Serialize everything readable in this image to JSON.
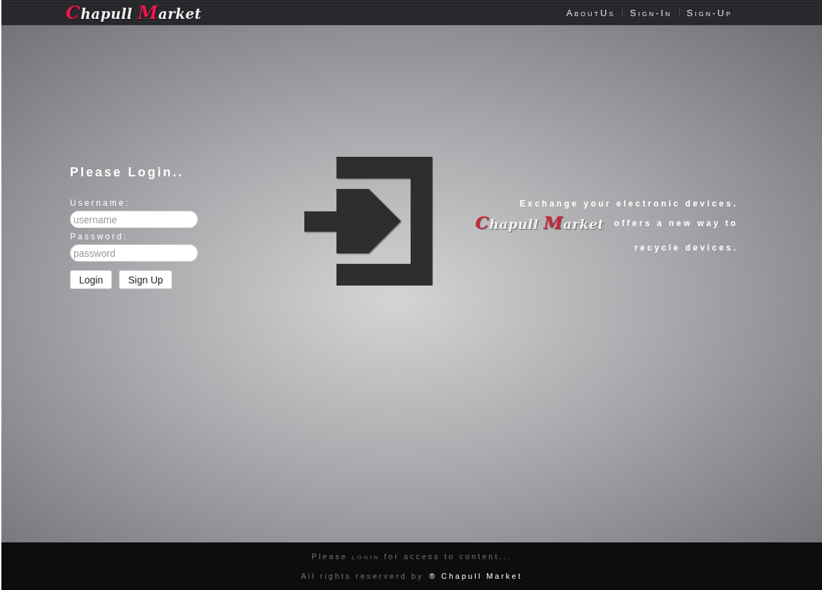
{
  "header": {
    "logo": "Chapull Market",
    "nav": [
      {
        "label": "AboutUs"
      },
      {
        "label": "Sign-In"
      },
      {
        "label": "Sign-Up"
      }
    ]
  },
  "login": {
    "title": "Please Login..",
    "fields": [
      {
        "label": "Username:",
        "placeholder": "username"
      },
      {
        "label": "Password:",
        "placeholder": "password"
      }
    ],
    "buttons": [
      "Login",
      "Sign Up"
    ]
  },
  "tagline": {
    "line1": "Exchange your electronic devices.",
    "logo": "Chapull Market",
    "line2": "offers a new way to",
    "line3": "recycle devices."
  },
  "footer": {
    "notice": [
      {
        "text": "Please ",
        "small_caps": false
      },
      {
        "text": "login",
        "small_caps": true
      },
      {
        "text": " for access to content...",
        "small_caps": false
      }
    ],
    "rights": "All rights reserverd by",
    "brand": "® Chapull Market"
  }
}
